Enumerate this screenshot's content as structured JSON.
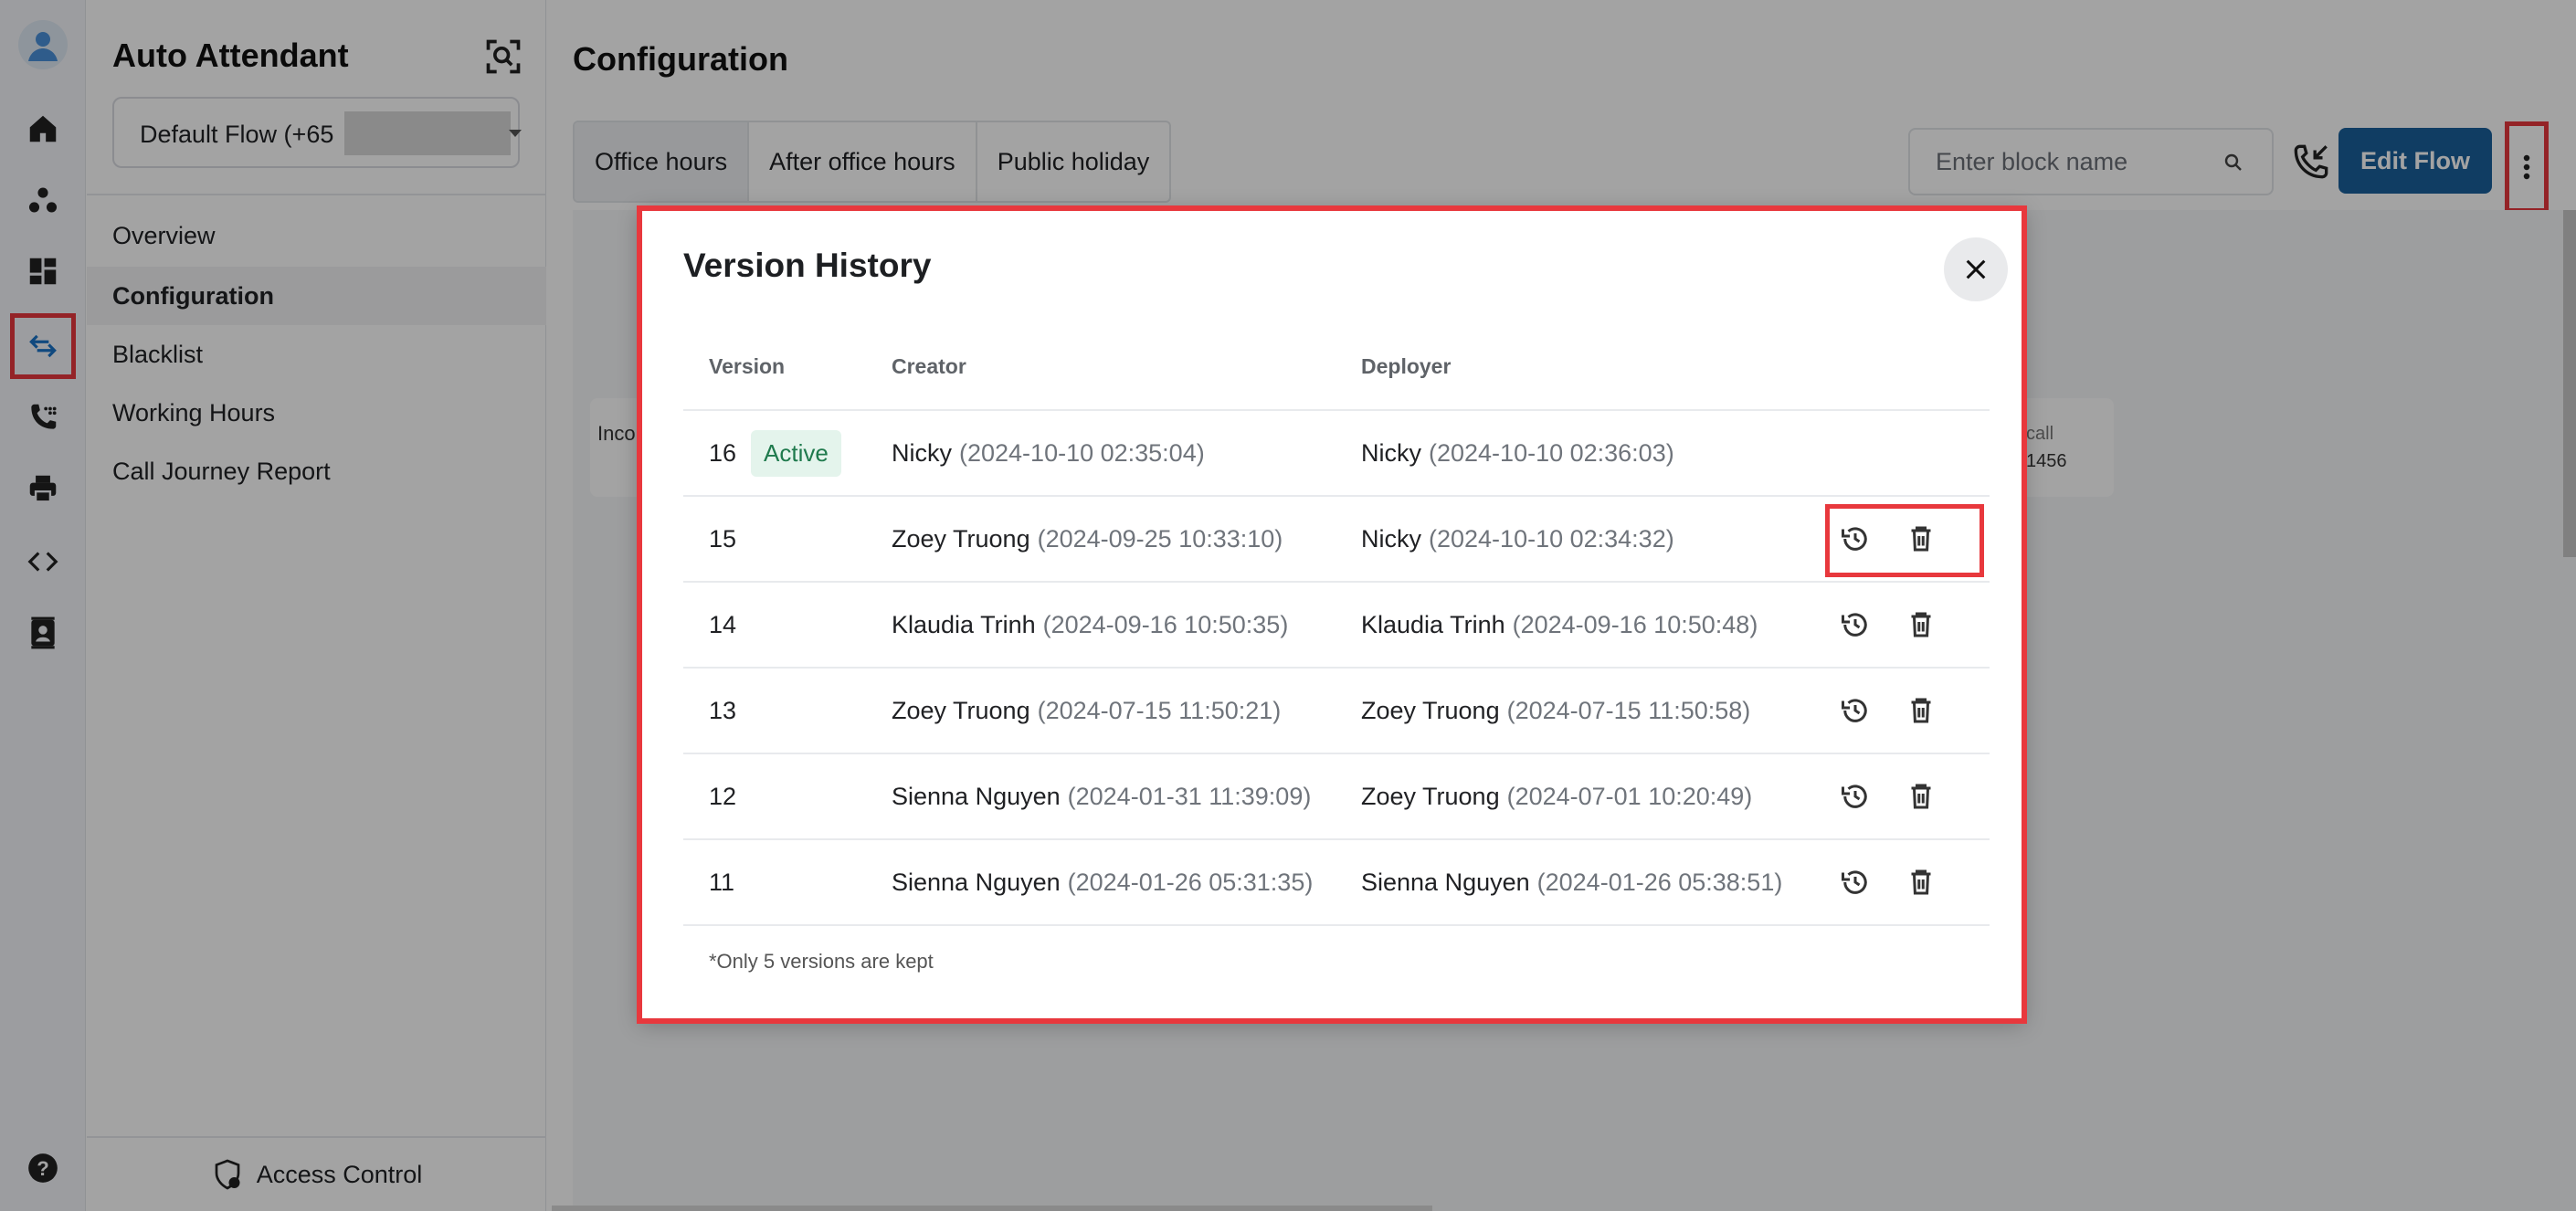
{
  "rail": {
    "items": [
      {
        "name": "home-icon"
      },
      {
        "name": "team-icon"
      },
      {
        "name": "dashboard-icon"
      },
      {
        "name": "call-flow-icon",
        "highlighted": true
      },
      {
        "name": "call-log-icon"
      },
      {
        "name": "fax-icon"
      },
      {
        "name": "developer-icon"
      },
      {
        "name": "contacts-icon"
      }
    ],
    "help": "help-icon"
  },
  "sidebar": {
    "title": "Auto Attendant",
    "flow_select": "Default Flow (+65",
    "nav": [
      {
        "label": "Overview",
        "active": false
      },
      {
        "label": "Configuration",
        "active": true
      },
      {
        "label": "Blacklist",
        "active": false
      },
      {
        "label": "Working Hours",
        "active": false
      },
      {
        "label": "Call Journey Report",
        "active": false
      }
    ],
    "access_control": "Access Control"
  },
  "main": {
    "title": "Configuration",
    "tabs": [
      {
        "label": "Office hours",
        "active": true
      },
      {
        "label": "After office hours",
        "active": false
      },
      {
        "label": "Public holiday",
        "active": false
      }
    ],
    "search_placeholder": "Enter block name",
    "edit_flow": "Edit Flow",
    "canvas": {
      "node_left_text": "Inco",
      "node_right_line1": "call",
      "node_right_line2": "1456"
    }
  },
  "modal": {
    "title": "Version History",
    "columns": {
      "version": "Version",
      "creator": "Creator",
      "deployer": "Deployer"
    },
    "rows": [
      {
        "version": "16",
        "badge": "Active",
        "creator": "Nicky",
        "creator_time": "(2024-10-10 02:35:04)",
        "deployer": "Nicky",
        "deployer_time": "(2024-10-10 02:36:03)"
      },
      {
        "version": "15",
        "badge": "",
        "creator": "Zoey Truong",
        "creator_time": "(2024-09-25 10:33:10)",
        "deployer": "Nicky",
        "deployer_time": "(2024-10-10 02:34:32)"
      },
      {
        "version": "14",
        "badge": "",
        "creator": "Klaudia Trinh",
        "creator_time": "(2024-09-16 10:50:35)",
        "deployer": "Klaudia Trinh",
        "deployer_time": "(2024-09-16 10:50:48)"
      },
      {
        "version": "13",
        "badge": "",
        "creator": "Zoey Truong",
        "creator_time": "(2024-07-15 11:50:21)",
        "deployer": "Zoey Truong",
        "deployer_time": "(2024-07-15 11:50:58)"
      },
      {
        "version": "12",
        "badge": "",
        "creator": "Sienna Nguyen",
        "creator_time": "(2024-01-31 11:39:09)",
        "deployer": "Zoey Truong",
        "deployer_time": "(2024-07-01 10:20:49)"
      },
      {
        "version": "11",
        "badge": "",
        "creator": "Sienna Nguyen",
        "creator_time": "(2024-01-26 05:31:35)",
        "deployer": "Sienna Nguyen",
        "deployer_time": "(2024-01-26 05:38:51)"
      }
    ],
    "note": "*Only 5 versions are kept"
  },
  "colors": {
    "primary": "#19609c",
    "highlight": "#e8383d",
    "active_badge_bg": "#e4f4ec",
    "active_badge_text": "#1f7a4d"
  }
}
